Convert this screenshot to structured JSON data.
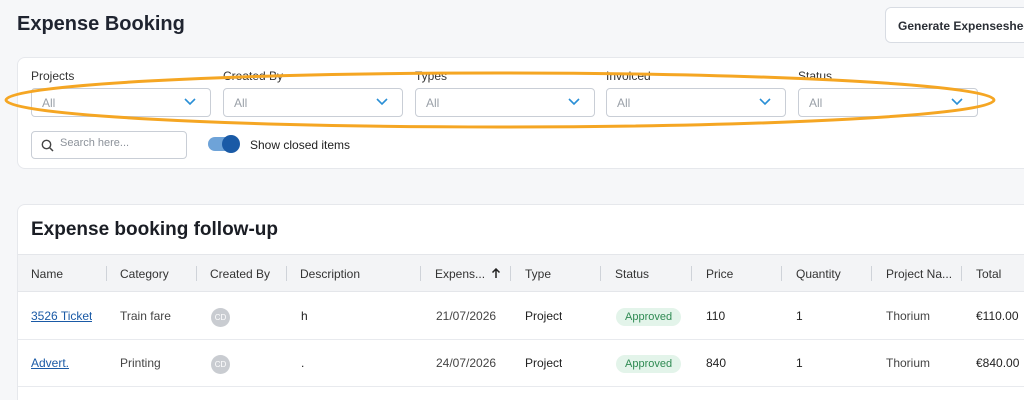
{
  "page": {
    "title": "Expense Booking",
    "generate_button": "Generate Expensesheet"
  },
  "filters": [
    {
      "label": "Projects",
      "value": "All"
    },
    {
      "label": "Created By",
      "value": "All"
    },
    {
      "label": "Types",
      "value": "All"
    },
    {
      "label": "Invoiced",
      "value": "All"
    },
    {
      "label": "Status",
      "value": "All"
    }
  ],
  "search": {
    "placeholder": "Search here..."
  },
  "toggle": {
    "label": "Show closed items",
    "on": true
  },
  "highlight_color": "#f5a623",
  "table": {
    "title": "Expense booking follow-up",
    "columns": [
      "Name",
      "Category",
      "Created By",
      "Description",
      "Expens...",
      "Type",
      "Status",
      "Price",
      "Quantity",
      "Project Na...",
      "Total"
    ],
    "sort_icon": "arrow-up-icon",
    "rows": [
      {
        "name": "3526 Ticket",
        "category": "Train fare",
        "created_by": "CD",
        "description": "h",
        "date": "21/07/2026",
        "type": "Project",
        "status": "Approved",
        "price": "110",
        "quantity": "1",
        "project": "Thorium",
        "total": "€110.00"
      },
      {
        "name": "Advert.",
        "category": "Printing",
        "created_by": "CD",
        "description": ".",
        "date": "24/07/2026",
        "type": "Project",
        "status": "Approved",
        "price": "840",
        "quantity": "1",
        "project": "Thorium",
        "total": "€840.00"
      }
    ]
  },
  "colors": {
    "accent": "#1a5aa6",
    "status_approved_bg": "#e3f4ea",
    "status_approved_text": "#2e8a52"
  }
}
